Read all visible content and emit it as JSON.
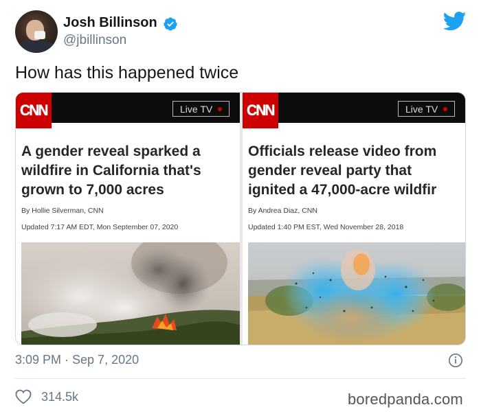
{
  "author": {
    "display_name": "Josh Billinson",
    "handle": "@jbillinson",
    "verified": true
  },
  "tweet": {
    "text": "How has this happened twice",
    "timestamp": "3:09 PM · Sep 7, 2020",
    "likes": "314.5k"
  },
  "articles": [
    {
      "outlet": "CNN",
      "live_label": "Live TV",
      "headline_lines": [
        "A gender reveal sparked a",
        "wildfire in California that's",
        "grown to 7,000 acres"
      ],
      "byline": "By Hollie Silverman, CNN",
      "updated": "Updated 7:17 AM EDT, Mon September 07, 2020",
      "image": "wildfire-smoke-photo"
    },
    {
      "outlet": "CNN",
      "live_label": "Live TV",
      "headline_lines": [
        "Officials release video from",
        "gender reveal party that",
        "ignited a 47,000-acre wildfir"
      ],
      "byline": "By Andrea Diaz, CNN",
      "updated": "Updated 1:40 PM EST, Wed November 28, 2018",
      "image": "blue-powder-explosion-photo"
    }
  ],
  "watermark": "boredpanda.com",
  "colors": {
    "twitter_blue": "#1da1f2",
    "cnn_red": "#cc0000",
    "muted_text": "#657786"
  },
  "icons": [
    "verified-icon",
    "twitter-bird-icon",
    "info-icon",
    "heart-icon"
  ]
}
